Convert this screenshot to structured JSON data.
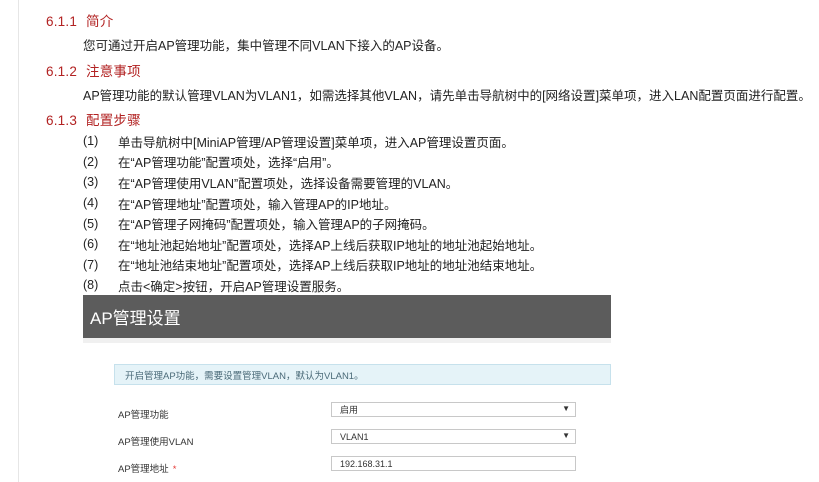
{
  "sections": [
    {
      "num": "6.1.1",
      "title": "简介"
    },
    {
      "num": "6.1.2",
      "title": "注意事项"
    },
    {
      "num": "6.1.3",
      "title": "配置步骤"
    }
  ],
  "intro_text": "您可通过开启AP管理功能，集中管理不同VLAN下接入的AP设备。",
  "notes_text": "AP管理功能的默认管理VLAN为VLAN1，如需选择其他VLAN，请先单击导航树中的[网络设置]菜单项，进入LAN配置页面进行配置。",
  "steps": [
    {
      "idx": "(1)",
      "text": "单击导航树中[MiniAP管理/AP管理设置]菜单项，进入AP管理设置页面。"
    },
    {
      "idx": "(2)",
      "text": "在“AP管理功能”配置项处，选择“启用”。"
    },
    {
      "idx": "(3)",
      "text": "在“AP管理使用VLAN”配置项处，选择设备需要管理的VLAN。"
    },
    {
      "idx": "(4)",
      "text": "在“AP管理地址”配置项处，输入管理AP的IP地址。"
    },
    {
      "idx": "(5)",
      "text": "在“AP管理子网掩码”配置项处，输入管理AP的子网掩码。"
    },
    {
      "idx": "(6)",
      "text": "在“地址池起始地址”配置项处，选择AP上线后获取IP地址的地址池起始地址。"
    },
    {
      "idx": "(7)",
      "text": "在“地址池结束地址”配置项处，选择AP上线后获取IP地址的地址池结束地址。"
    },
    {
      "idx": "(8)",
      "text": "点击<确定>按钮，开启AP管理设置服务。"
    }
  ],
  "screenshot": {
    "title": "AP管理设置",
    "tip": "开启管理AP功能，需要设置管理VLAN，默认为VLAN1。",
    "fields": [
      {
        "label": "AP管理功能",
        "value": "启用",
        "type": "select",
        "required": false
      },
      {
        "label": "AP管理使用VLAN",
        "value": "VLAN1",
        "type": "select",
        "required": false
      },
      {
        "label": "AP管理地址",
        "value": "192.168.31.1",
        "type": "input",
        "required": true
      }
    ],
    "required_mark": "*",
    "caret": "▼"
  }
}
